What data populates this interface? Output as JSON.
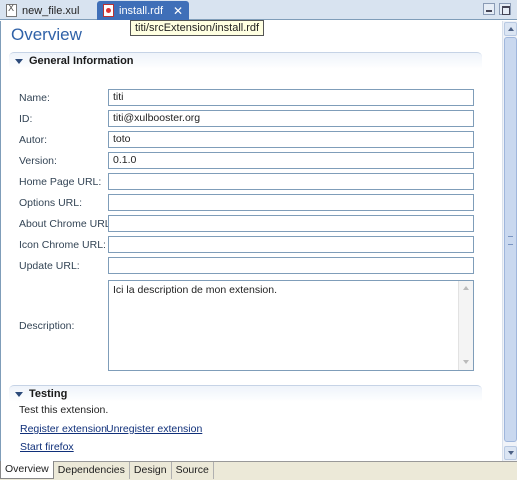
{
  "tabs": [
    {
      "label": "new_file.xul",
      "icon": "xul-file-icon",
      "active": false
    },
    {
      "label": "install.rdf",
      "icon": "rdf-file-icon",
      "active": true
    }
  ],
  "tooltip": "titi/srcExtension/install.rdf",
  "page_title": "Overview",
  "general": {
    "header": "General Information",
    "fields": [
      {
        "label": "Name:",
        "value": "titi"
      },
      {
        "label": "ID:",
        "value": "titi@xulbooster.org"
      },
      {
        "label": "Autor:",
        "value": "toto"
      },
      {
        "label": "Version:",
        "value": "0.1.0"
      },
      {
        "label": "Home Page URL:",
        "value": ""
      },
      {
        "label": "Options URL:",
        "value": ""
      },
      {
        "label": "About Chrome URL:",
        "value": ""
      },
      {
        "label": "Icon Chrome URL:",
        "value": ""
      },
      {
        "label": "Update URL:",
        "value": ""
      }
    ],
    "description_label": "Description:",
    "description_value": "Ici la description de mon extension."
  },
  "testing": {
    "header": "Testing",
    "description": "Test this extension.",
    "register_link": "Register extension",
    "unregister_link": "Unregister extension",
    "start_link": "Start firefox"
  },
  "bottom_tabs": [
    {
      "label": "Overview",
      "active": true
    },
    {
      "label": "Dependencies",
      "active": false
    },
    {
      "label": "Design",
      "active": false
    },
    {
      "label": "Source",
      "active": false
    }
  ],
  "colors": {
    "title": "#3062a8",
    "active_tab": "#3f6fb8",
    "link": "#10307a"
  }
}
